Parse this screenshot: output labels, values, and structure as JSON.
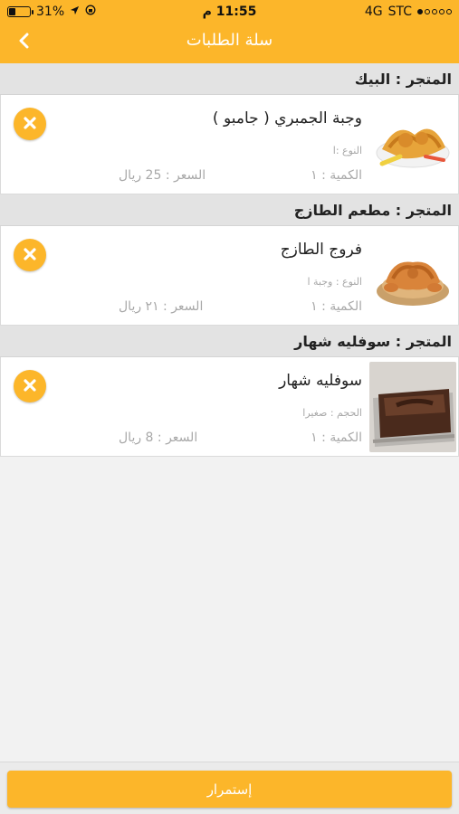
{
  "status_bar": {
    "battery": "31%",
    "battery_level": 0.31,
    "time": "11:55 م",
    "carrier": "STC",
    "network": "4G",
    "signal_bars": 1
  },
  "header": {
    "title": "سلة الطلبات",
    "back_icon": "chevron-left-icon"
  },
  "colors": {
    "accent": "#fcb62a",
    "header_bg": "#e3e3e3"
  },
  "stores": [
    {
      "label": "المتجر : البيك",
      "item": {
        "name": "وجبة الجمبري ( جامبو )",
        "attribute": "النوع :ا",
        "quantity": "الكمية : ١",
        "price": "السعر : 25 ريال",
        "image": "shrimp-meal-image"
      }
    },
    {
      "label": "المتجر : مطعم الطازج",
      "item": {
        "name": "فروج الطازج",
        "attribute": "النوع : وجبة ا",
        "quantity": "الكمية : ١",
        "price": "السعر : ٢١ ريال",
        "image": "grilled-chicken-image"
      }
    },
    {
      "label": "المتجر : سوفليه شهار",
      "item": {
        "name": "سوفليه شهار",
        "attribute": "الحجم : صغيرا",
        "quantity": "الكمية : ١",
        "price": "السعر : 8 ريال",
        "image": "chocolate-souffle-image"
      }
    }
  ],
  "footer": {
    "continue_label": "إستمرار"
  }
}
